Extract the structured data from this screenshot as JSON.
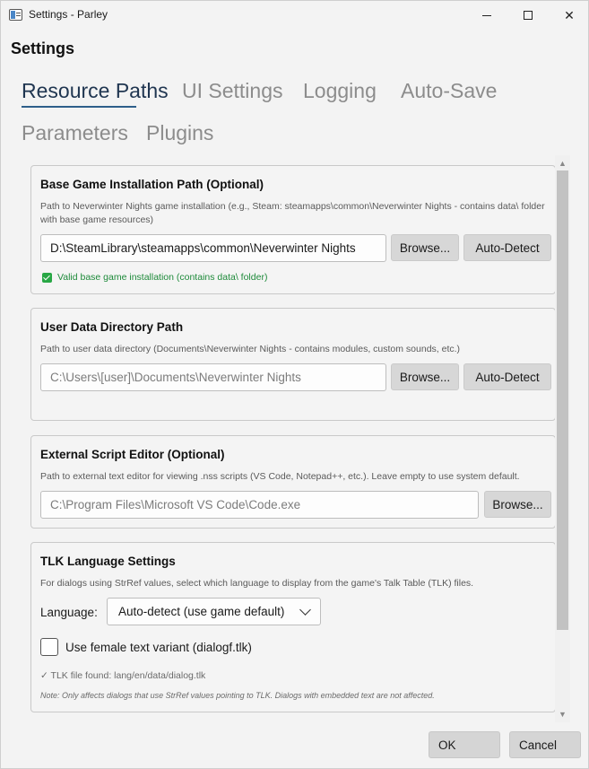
{
  "window": {
    "title": "Settings - Parley",
    "minimize_icon": "minimize-icon",
    "maximize_icon": "maximize-icon",
    "close_icon": "close-icon"
  },
  "header": {
    "title": "Settings"
  },
  "tabs": [
    {
      "label": "Resource Paths",
      "active": true
    },
    {
      "label": "UI Settings",
      "active": false
    },
    {
      "label": "Logging",
      "active": false
    },
    {
      "label": "Auto-Save",
      "active": false
    },
    {
      "label": "Parameters",
      "active": false
    },
    {
      "label": "Plugins",
      "active": false
    }
  ],
  "base_game": {
    "title": "Base Game Installation Path (Optional)",
    "description": "Path to Neverwinter Nights game installation (e.g., Steam: steamapps\\common\\Neverwinter Nights - contains data\\ folder with base game resources)",
    "path_value": "D:\\SteamLibrary\\steamapps\\common\\Neverwinter Nights",
    "browse_label": "Browse...",
    "autodetect_label": "Auto-Detect",
    "valid_text": "Valid base game installation (contains data\\ folder)"
  },
  "user_data": {
    "title": "User Data Directory Path",
    "description": "Path to user data directory (Documents\\Neverwinter Nights - contains modules, custom sounds, etc.)",
    "path_placeholder": "C:\\Users\\[user]\\Documents\\Neverwinter Nights",
    "browse_label": "Browse...",
    "autodetect_label": "Auto-Detect"
  },
  "script_editor": {
    "title": "External Script Editor (Optional)",
    "description": "Path to external text editor for viewing .nss scripts (VS Code, Notepad++, etc.). Leave empty to use system default.",
    "path_placeholder": "C:\\Program Files\\Microsoft VS Code\\Code.exe",
    "browse_label": "Browse..."
  },
  "tlk": {
    "title": "TLK Language Settings",
    "description": "For dialogs using StrRef values, select which language to display from the game's Talk Table (TLK) files.",
    "language_label": "Language:",
    "language_value": "Auto-detect (use game default)",
    "female_label": "Use female text variant (dialogf.tlk)",
    "female_checked": false,
    "found_text": "✓ TLK file found: lang/en/data/dialog.tlk",
    "note": "Note: Only affects dialogs that use StrRef values pointing to TLK. Dialogs with embedded text are not affected."
  },
  "footer": {
    "ok_label": "OK",
    "cancel_label": "Cancel"
  },
  "colors": {
    "accent": "#2e5f8a",
    "valid": "#28a745",
    "inactive_tab": "#8c8c8c"
  }
}
